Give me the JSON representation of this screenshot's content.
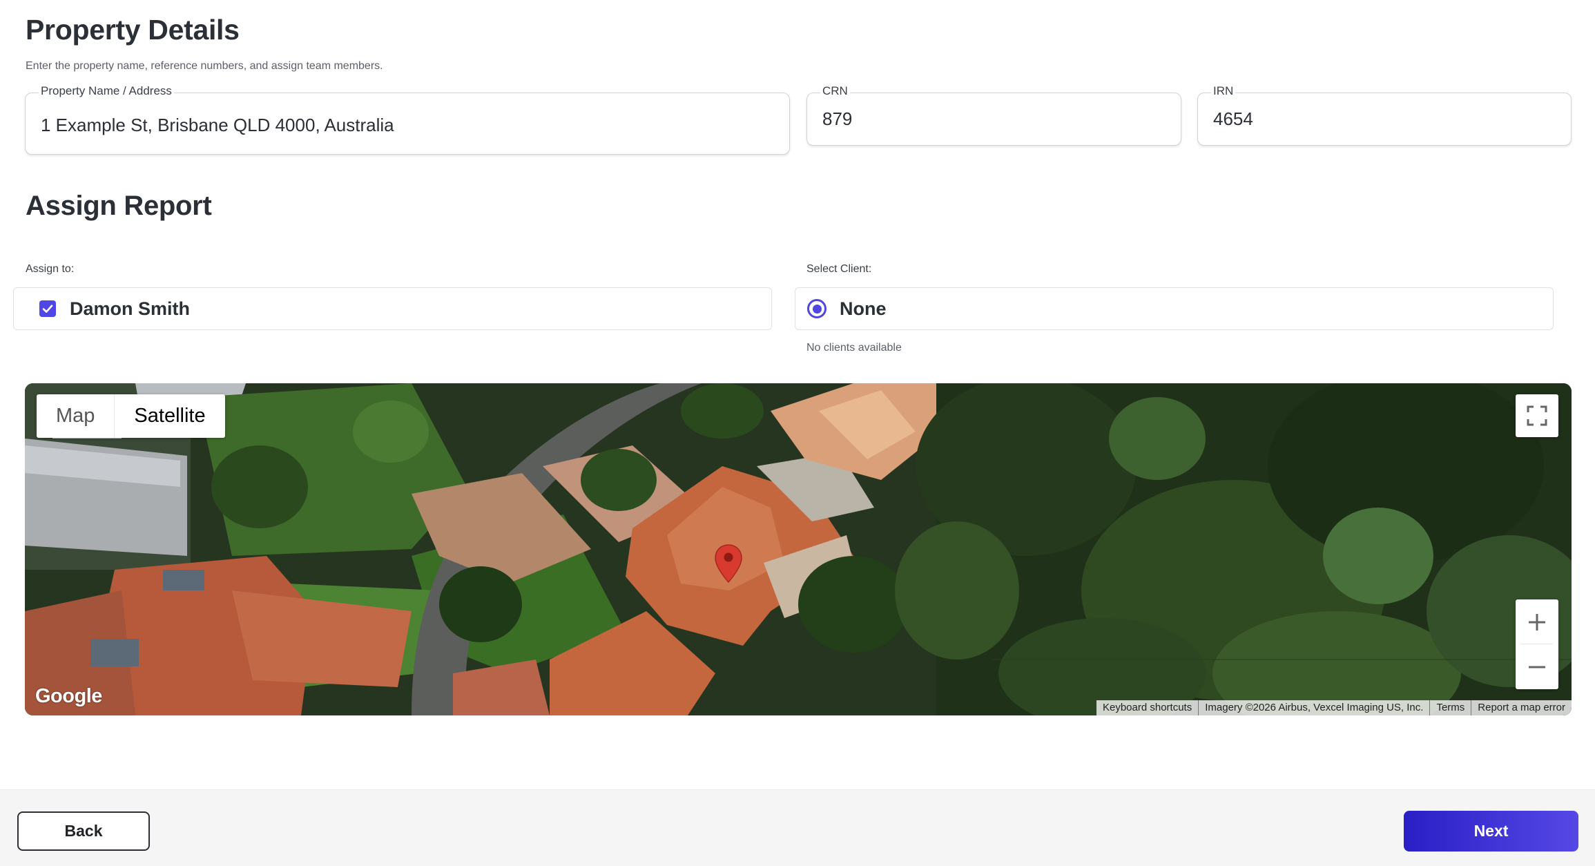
{
  "property": {
    "title": "Property Details",
    "subtitle": "Enter the property name, reference numbers, and assign team members.",
    "address_label": "Property Name / Address",
    "address_value": "1 Example St, Brisbane QLD 4000, Australia",
    "crn_label": "CRN",
    "crn_value": "879",
    "irn_label": "IRN",
    "irn_value": "4654"
  },
  "assign": {
    "title": "Assign Report",
    "assign_to_label": "Assign to:",
    "assignee": "Damon Smith",
    "assignee_checked": true,
    "client_label": "Select Client:",
    "client_option": "None",
    "client_selected": true,
    "client_hint": "No clients available"
  },
  "map": {
    "type_map": "Map",
    "type_satellite": "Satellite",
    "active_type": "Satellite",
    "logo": "Google",
    "attribution": {
      "shortcuts": "Keyboard shortcuts",
      "imagery": "Imagery ©2026 Airbus, Vexcel Imaging US, Inc.",
      "terms": "Terms",
      "report": "Report a map error"
    },
    "icons": {
      "fullscreen": "fullscreen-icon",
      "zoom_in": "plus-icon",
      "zoom_out": "minus-icon",
      "marker": "map-pin-icon"
    },
    "marker_color": "#d93a2f"
  },
  "footer": {
    "back_label": "Back",
    "next_label": "Next"
  },
  "colors": {
    "accent": "#4f46e5",
    "next_gradient_start": "#2a1fc5",
    "next_gradient_end": "#5548e6"
  }
}
